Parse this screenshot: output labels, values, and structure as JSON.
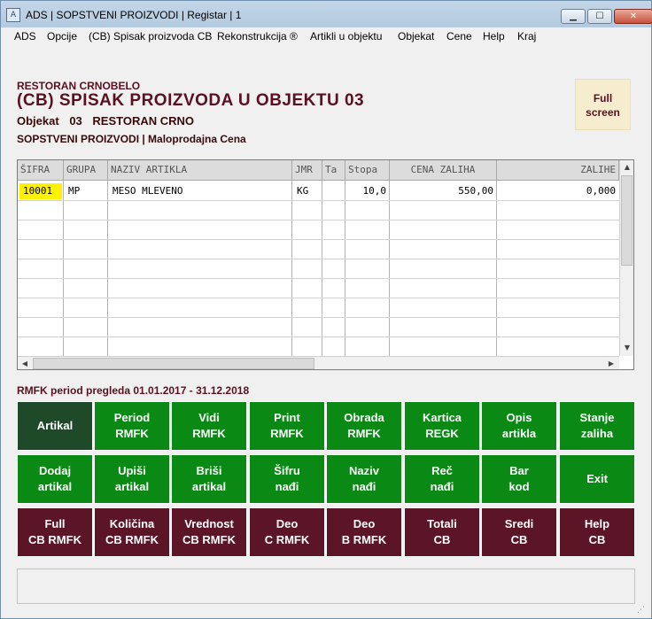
{
  "window": {
    "title": "ADS | SOPSTVENI PROIZVODI | Registar | 1",
    "icon": "app-icon",
    "controls": {
      "minimize": "▁",
      "maximize": "☐",
      "close": "✕"
    }
  },
  "menu": [
    "ADS",
    "Opcije",
    "(CB) Spisak proizvoda CB",
    "Rekonstrukcija ®",
    "Artikli u objektu",
    "Objekat",
    "Cene",
    "Help",
    "Kraj"
  ],
  "header": {
    "company": "RESTORAN CRNOBELO",
    "title": "(CB) SPISAK PROIZVODA U OBJEKTU 03",
    "objekat_label": "Objekat",
    "objekat_number": "03",
    "objekat_name": "RESTORAN CRNO",
    "subtitle": "SOPSTVENI PROIZVODI | Maloprodajna Cena"
  },
  "fullscreen": {
    "line1": "Full",
    "line2": "screen"
  },
  "table": {
    "columns": [
      "ŠIFRA",
      "GRUPA",
      "NAZIV ARTIKLA",
      "JMR",
      "Ta",
      "Stopa",
      "CENA ZALIHA",
      "ZALIHE"
    ],
    "rows": [
      {
        "sifra": "10001",
        "grupa": "MP",
        "naziv": "MESO MLEVENO",
        "jmr": "KG",
        "ta": "",
        "stopa": "10,0",
        "cena": "550,00",
        "zalihe": "0,000"
      }
    ]
  },
  "period": "RMFK period pregleda 01.01.2017 - 31.12.2018",
  "buttons": {
    "row1": [
      {
        "l1": "Artikal",
        "l2": "",
        "name": "artikal-button"
      },
      {
        "l1": "Period",
        "l2": "RMFK",
        "name": "period-rmfk-button"
      },
      {
        "l1": "Vidi",
        "l2": "RMFK",
        "name": "vidi-rmfk-button"
      },
      {
        "l1": "Print",
        "l2": "RMFK",
        "name": "print-rmfk-button"
      },
      {
        "l1": "Obrada",
        "l2": "RMFK",
        "name": "obrada-rmfk-button"
      },
      {
        "l1": "Kartica",
        "l2": "REGK",
        "name": "kartica-regk-button"
      },
      {
        "l1": "Opis",
        "l2": "artikla",
        "name": "opis-artikla-button"
      },
      {
        "l1": "Stanje",
        "l2": "zaliha",
        "name": "stanje-zaliha-button"
      }
    ],
    "row2": [
      {
        "l1": "Dodaj",
        "l2": "artikal",
        "name": "dodaj-artikal-button"
      },
      {
        "l1": "Upiši",
        "l2": "artikal",
        "name": "upisi-artikal-button"
      },
      {
        "l1": "Briši",
        "l2": "artikal",
        "name": "brisi-artikal-button"
      },
      {
        "l1": "Šifru",
        "l2": "nađi",
        "name": "sifru-nadji-button"
      },
      {
        "l1": "Naziv",
        "l2": "nađi",
        "name": "naziv-nadji-button"
      },
      {
        "l1": "Reč",
        "l2": "nađi",
        "name": "rec-nadji-button"
      },
      {
        "l1": "Bar",
        "l2": "kod",
        "name": "bar-kod-button"
      },
      {
        "l1": "Exit",
        "l2": "",
        "name": "exit-button"
      }
    ],
    "row3": [
      {
        "l1": "Full",
        "l2": "CB RMFK",
        "name": "full-cb-rmfk-button"
      },
      {
        "l1": "Količina",
        "l2": "CB RMFK",
        "name": "kolicina-cb-rmfk-button"
      },
      {
        "l1": "Vrednost",
        "l2": "CB RMFK",
        "name": "vrednost-cb-rmfk-button"
      },
      {
        "l1": "Deo",
        "l2": "C RMFK",
        "name": "deo-c-rmfk-button"
      },
      {
        "l1": "Deo",
        "l2": "B RMFK",
        "name": "deo-b-rmfk-button"
      },
      {
        "l1": "Totali",
        "l2": "CB",
        "name": "totali-cb-button"
      },
      {
        "l1": "Sredi",
        "l2": "CB",
        "name": "sredi-cb-button"
      },
      {
        "l1": "Help",
        "l2": "CB",
        "name": "help-cb-button"
      }
    ]
  },
  "colors": {
    "green": "#0a8a14",
    "dark_green": "#1f4a2a",
    "maroon": "#5c1526",
    "header_text": "#5a1020",
    "highlight": "#fff200"
  },
  "scroll": {
    "up": "▲",
    "down": "▼",
    "left": "◀",
    "right": "▶"
  }
}
